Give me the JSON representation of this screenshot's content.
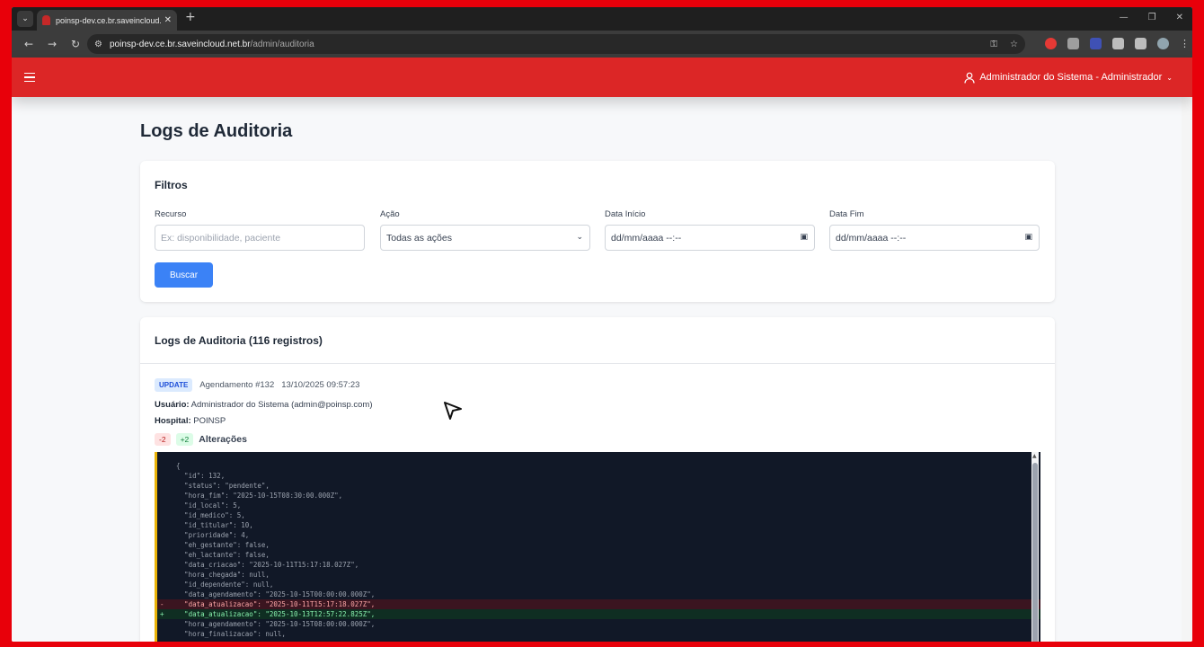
{
  "browser": {
    "tab_title": "poinsp-dev.ce.br.saveincloud.net.br/admin/auditoria",
    "new_tab": "+",
    "url_host": "poinsp-dev.ce.br.saveincloud.net.br",
    "url_path": "/admin/auditoria"
  },
  "app": {
    "user_label": "Administrador do Sistema - Administrador"
  },
  "page": {
    "title": "Logs de Auditoria"
  },
  "filters": {
    "title": "Filtros",
    "recurso_label": "Recurso",
    "recurso_placeholder": "Ex: disponibilidade, paciente",
    "acao_label": "Ação",
    "acao_value": "Todas as ações",
    "data_inicio_label": "Data Início",
    "data_inicio_value": "dd/mm/aaaa --:--",
    "data_fim_label": "Data Fim",
    "data_fim_value": "dd/mm/aaaa --:--",
    "buscar_label": "Buscar"
  },
  "logs": {
    "title": "Logs de Auditoria (116 registros)",
    "entry": {
      "action": "UPDATE",
      "resource": "Agendamento #132",
      "timestamp": "13/10/2025 09:57:23",
      "usuario_label": "Usuário:",
      "usuario_value": "Administrador do Sistema (admin@poinsp.com)",
      "hospital_label": "Hospital:",
      "hospital_value": "POINSP",
      "removed": "-2",
      "added": "+2",
      "changes_label": "Alterações",
      "code_lines": [
        {
          "text": "{",
          "kind": "ctx"
        },
        {
          "text": "  \"id\": 132,",
          "kind": "ctx"
        },
        {
          "text": "  \"status\": \"pendente\",",
          "kind": "ctx"
        },
        {
          "text": "  \"hora_fim\": \"2025-10-15T08:30:00.000Z\",",
          "kind": "ctx"
        },
        {
          "text": "  \"id_local\": 5,",
          "kind": "ctx"
        },
        {
          "text": "  \"id_medico\": 5,",
          "kind": "ctx"
        },
        {
          "text": "  \"id_titular\": 10,",
          "kind": "ctx"
        },
        {
          "text": "  \"prioridade\": 4,",
          "kind": "ctx"
        },
        {
          "text": "  \"eh_gestante\": false,",
          "kind": "ctx"
        },
        {
          "text": "  \"eh_lactante\": false,",
          "kind": "ctx"
        },
        {
          "text": "  \"data_criacao\": \"2025-10-11T15:17:18.027Z\",",
          "kind": "ctx"
        },
        {
          "text": "  \"hora_chegada\": null,",
          "kind": "ctx"
        },
        {
          "text": "  \"id_dependente\": null,",
          "kind": "ctx"
        },
        {
          "text": "  \"data_agendamento\": \"2025-10-15T00:00:00.000Z\",",
          "kind": "ctx"
        },
        {
          "text": "  \"data_atualizacao\": \"2025-10-11T15:17:18.027Z\",",
          "kind": "del"
        },
        {
          "text": "  \"data_atualizacao\": \"2025-10-13T12:57:22.825Z\",",
          "kind": "add"
        },
        {
          "text": "  \"hora_agendamento\": \"2025-10-15T08:00:00.000Z\",",
          "kind": "ctx"
        },
        {
          "text": "  \"hora_finalizacao\": null,",
          "kind": "ctx"
        }
      ]
    }
  },
  "colors": {
    "appbar": "#dc2626",
    "primary_button": "#3b82f6",
    "code_bg": "#111827"
  }
}
